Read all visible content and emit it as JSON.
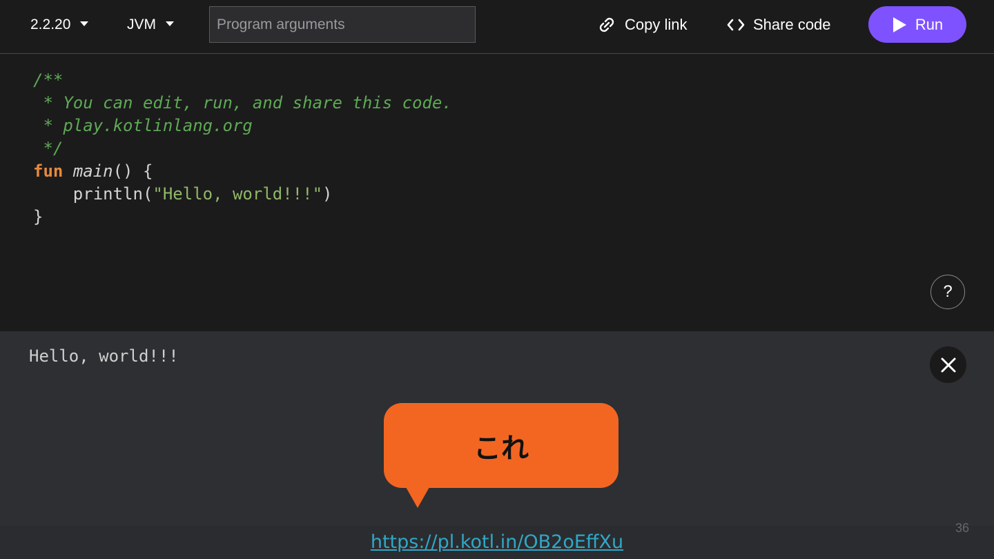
{
  "toolbar": {
    "version_label": "2.2.20",
    "target_label": "JVM",
    "args_placeholder": "Program arguments",
    "copy_link_label": "Copy link",
    "share_code_label": "Share code",
    "run_label": "Run"
  },
  "editor": {
    "code_lines": {
      "l1": "/**",
      "l2": " * You can edit, run, and share this code.",
      "l3": " * play.kotlinlang.org",
      "l4": " */",
      "l5_kw": "fun",
      "l5_fn": "main",
      "l5_rest": "() {",
      "l6_pre": "    println(",
      "l6_str": "\"Hello, world!!!\"",
      "l6_post": ")",
      "l7": "}"
    },
    "help_label": "?"
  },
  "output": {
    "text": "Hello, world!!!"
  },
  "callout": {
    "text": "これ"
  },
  "footer": {
    "link_text": "https://pl.kotl.in/OB2oEffXu",
    "page_number": "36"
  },
  "icons": {
    "version_caret": "chevron-down-icon",
    "target_caret": "chevron-down-icon",
    "copy_link": "link-icon",
    "share_code": "code-brackets-icon",
    "run": "play-icon",
    "close": "close-icon"
  },
  "colors": {
    "accent": "#7f52ff",
    "callout": "#f26622",
    "comment": "#5fa955",
    "keyword": "#e68a3d",
    "string": "#8fb867",
    "link": "#2fa8c9"
  }
}
